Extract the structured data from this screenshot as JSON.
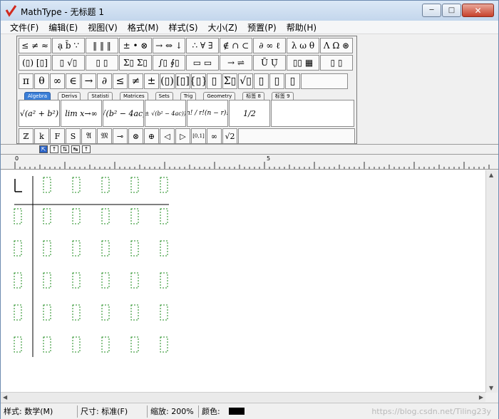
{
  "window": {
    "title": "MathType - 无标题 1"
  },
  "window_controls": {
    "minimize": "─",
    "maximize": "□",
    "close": "✕"
  },
  "menu": [
    "文件(F)",
    "编辑(E)",
    "视图(V)",
    "格式(M)",
    "样式(S)",
    "大小(Z)",
    "预置(P)",
    "帮助(H)"
  ],
  "palette": {
    "row1": [
      "≤ ≠ ≈",
      "ạ b̄ ∵",
      "‖ ‖ ‖",
      "± • ⊗",
      "→ ⇔ ↓",
      "∴ ∀ ∃",
      "∉ ∩ ⊂",
      "∂ ∞ ℓ",
      "λ ω θ",
      "Λ Ω ⊛"
    ],
    "row2": [
      "(▯) [▯]",
      "▯ √▯",
      "▯ ▯",
      "Σ▯ Σ▯",
      "∫▯ ∮▯",
      "▭ ▭",
      "→ ⇌",
      "Ū Ụ̈",
      "▯▯ ▦",
      "▯ ▯"
    ],
    "row3": [
      "π",
      "θ",
      "∞",
      "∈",
      "→",
      "∂",
      "≤",
      "≠",
      "±",
      "(▯)",
      "[▯]",
      "{▯}",
      "▯",
      "Σ▯",
      "√▯",
      "▯",
      "▯",
      "▯"
    ],
    "tabs": [
      "Algebra",
      "Derivs",
      "Statisti",
      "Matrices",
      "Sets",
      "Trig",
      "Geometry",
      "标签 8",
      "标签 9"
    ],
    "active_tab": "Algebra",
    "templates": [
      "√(a² + b²)",
      "lim x→∞",
      "√(b² − 4ac)",
      "(−b ± √(b² − 4ac)) / 2a",
      "n! / r!(n − r)!",
      "1/2"
    ],
    "row5": [
      "ℤ",
      "k",
      "F",
      "S",
      "𝔄",
      "𝔐",
      "⊸",
      "⊗",
      "⊕",
      "◁",
      "▷",
      "[0,1]",
      "∞",
      "√2"
    ]
  },
  "align_buttons": [
    "⇱",
    "↑",
    "⇅",
    "↹",
    "↑"
  ],
  "ruler": {
    "labels": [
      "0",
      "5"
    ]
  },
  "matrix": {
    "rows": 6,
    "cols": 6
  },
  "status": {
    "style_label": "样式: 数学(M)",
    "size_label": "尺寸: 标准(F)",
    "zoom_label": "缩放: 200%",
    "color_label": "颜色:",
    "color_value": "#000000"
  },
  "watermark": "https://blog.csdn.net/Tiling23y"
}
